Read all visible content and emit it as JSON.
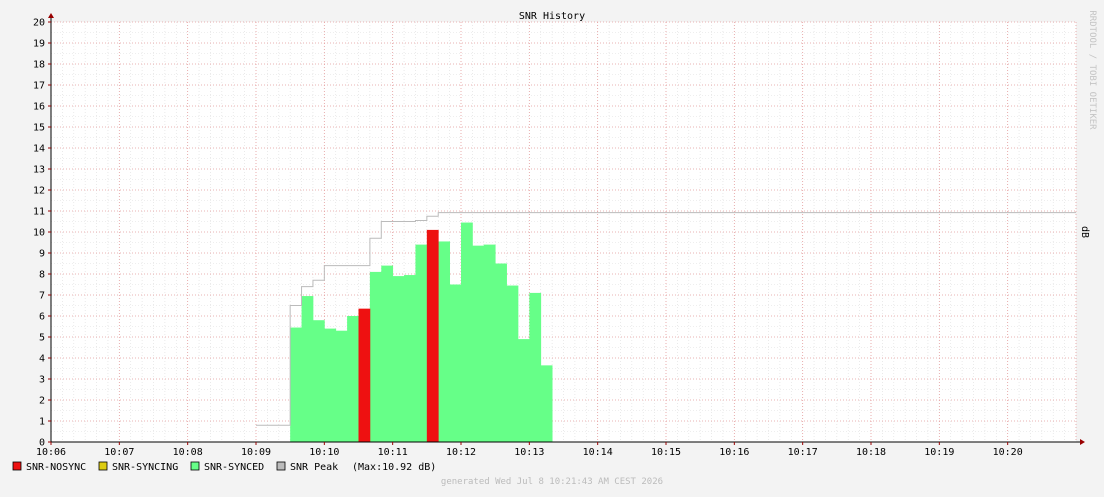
{
  "chart_data": {
    "type": "bar",
    "title": "SNR History",
    "ylabel": "dB",
    "watermark": "RRDTOOL / TOBI OETIKER",
    "footer": "generated Wed Jul  8 10:21:43 AM CEST 2026",
    "ylim": [
      0,
      20
    ],
    "yticks": [
      "0",
      "1",
      "2",
      "3",
      "4",
      "5",
      "6",
      "7",
      "8",
      "9",
      "10",
      "11",
      "12",
      "13",
      "14",
      "15",
      "16",
      "17",
      "18",
      "19",
      "20"
    ],
    "xlim": [
      "10:06",
      "10:21"
    ],
    "xticks": [
      "10:06",
      "10:07",
      "10:08",
      "10:09",
      "10:10",
      "10:11",
      "10:12",
      "10:13",
      "10:14",
      "10:15",
      "10:16",
      "10:17",
      "10:18",
      "10:19",
      "10:20"
    ],
    "grid": true,
    "legend_position": "bottom-left",
    "colors": {
      "nosync": "#ee1111",
      "syncing": "#ddcc11",
      "synced": "#66ff88",
      "peak": "#bbbbbb",
      "grid": "#e39a9a",
      "axis": "#990000"
    },
    "legend": [
      {
        "key": "nosync",
        "label": "SNR-NOSYNC"
      },
      {
        "key": "syncing",
        "label": "SNR-SYNCING"
      },
      {
        "key": "synced",
        "label": "SNR-SYNCED"
      },
      {
        "key": "peak",
        "label": "SNR Peak",
        "extra": "(Max:10.92 dB)"
      }
    ],
    "series": [
      {
        "name": "SNR-SYNCED",
        "key": "synced",
        "segments": [
          {
            "start": "10:09:30",
            "end": "10:09:40",
            "value": 5.45
          },
          {
            "start": "10:09:40",
            "end": "10:09:50",
            "value": 6.95
          },
          {
            "start": "10:09:50",
            "end": "10:10:00",
            "value": 5.8
          },
          {
            "start": "10:10:00",
            "end": "10:10:10",
            "value": 5.4
          },
          {
            "start": "10:10:10",
            "end": "10:10:20",
            "value": 5.3
          },
          {
            "start": "10:10:20",
            "end": "10:10:30",
            "value": 6.0
          },
          {
            "start": "10:10:40",
            "end": "10:10:50",
            "value": 8.1
          },
          {
            "start": "10:10:50",
            "end": "10:11:00",
            "value": 8.4
          },
          {
            "start": "10:11:00",
            "end": "10:11:10",
            "value": 7.9
          },
          {
            "start": "10:11:10",
            "end": "10:11:20",
            "value": 7.95
          },
          {
            "start": "10:11:20",
            "end": "10:11:30",
            "value": 9.4
          },
          {
            "start": "10:11:40",
            "end": "10:11:50",
            "value": 9.55
          },
          {
            "start": "10:11:50",
            "end": "10:12:00",
            "value": 7.5
          },
          {
            "start": "10:12:00",
            "end": "10:12:10",
            "value": 10.45
          },
          {
            "start": "10:12:10",
            "end": "10:12:20",
            "value": 9.35
          },
          {
            "start": "10:12:20",
            "end": "10:12:30",
            "value": 9.4
          },
          {
            "start": "10:12:30",
            "end": "10:12:40",
            "value": 8.5
          },
          {
            "start": "10:12:40",
            "end": "10:12:50",
            "value": 7.45
          },
          {
            "start": "10:12:50",
            "end": "10:13:00",
            "value": 4.9
          },
          {
            "start": "10:13:00",
            "end": "10:13:10",
            "value": 7.1
          },
          {
            "start": "10:13:10",
            "end": "10:13:20",
            "value": 3.65
          }
        ]
      },
      {
        "name": "SNR-NOSYNC",
        "key": "nosync",
        "segments": [
          {
            "start": "10:10:30",
            "end": "10:10:40",
            "value": 6.35
          },
          {
            "start": "10:11:30",
            "end": "10:11:40",
            "value": 10.1
          }
        ]
      },
      {
        "name": "SNR-SYNCING",
        "key": "syncing",
        "segments": []
      }
    ],
    "peak": {
      "name": "SNR Peak",
      "key": "peak",
      "max": 10.92,
      "points": [
        {
          "t": "10:09:00",
          "v": 0.8
        },
        {
          "t": "10:09:30",
          "v": 6.5
        },
        {
          "t": "10:09:40",
          "v": 7.4
        },
        {
          "t": "10:09:50",
          "v": 7.7
        },
        {
          "t": "10:10:00",
          "v": 8.4
        },
        {
          "t": "10:10:30",
          "v": 8.4
        },
        {
          "t": "10:10:40",
          "v": 9.7
        },
        {
          "t": "10:10:50",
          "v": 10.5
        },
        {
          "t": "10:11:20",
          "v": 10.55
        },
        {
          "t": "10:11:30",
          "v": 10.75
        },
        {
          "t": "10:11:40",
          "v": 10.92
        },
        {
          "t": "10:21:00",
          "v": 10.92
        }
      ]
    }
  }
}
